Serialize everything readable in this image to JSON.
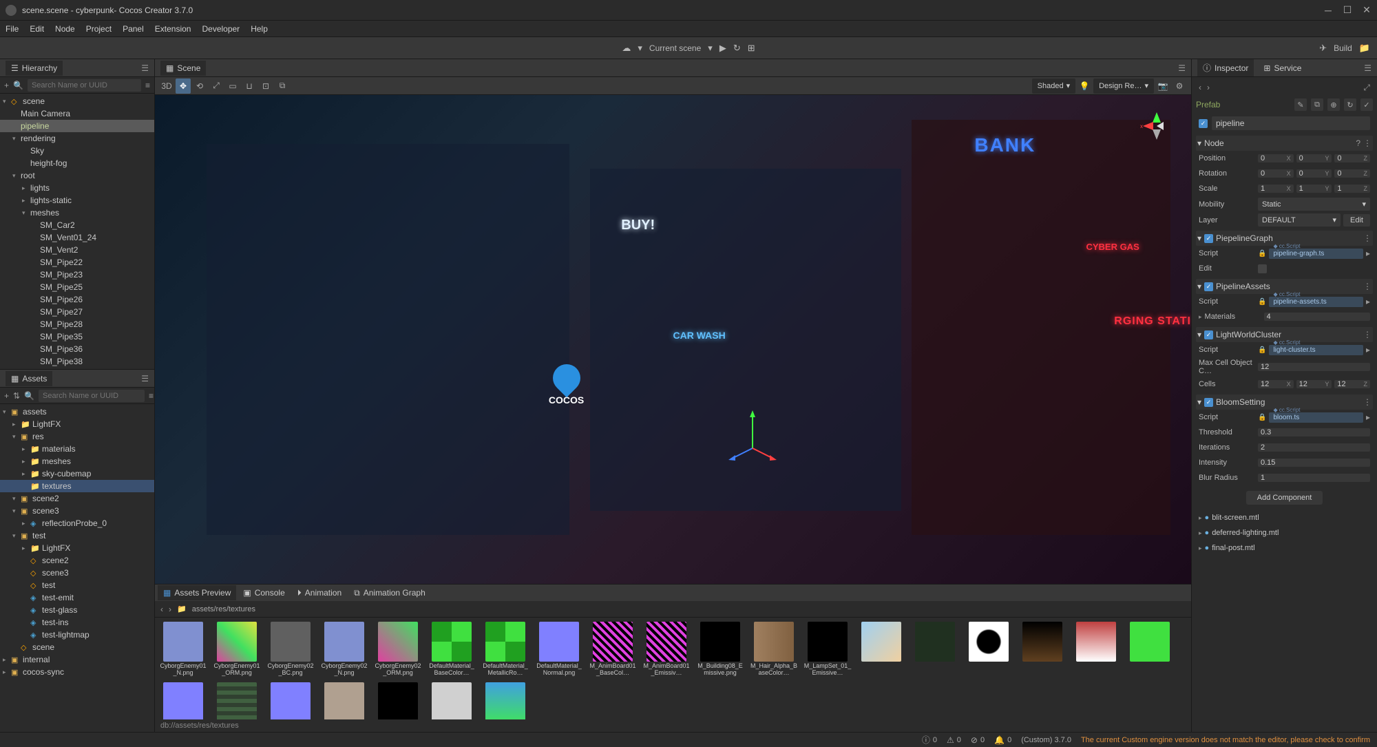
{
  "title": "scene.scene - cyberpunk- Cocos Creator 3.7.0",
  "menubar": [
    "File",
    "Edit",
    "Node",
    "Project",
    "Panel",
    "Extension",
    "Developer",
    "Help"
  ],
  "toolbar": {
    "scene_label": "Current scene",
    "build_label": "Build"
  },
  "tabs": {
    "hierarchy": "Hierarchy",
    "scene": "Scene",
    "assets": "Assets",
    "inspector": "Inspector",
    "service": "Service"
  },
  "search_placeholder": "Search Name or UUID",
  "hierarchy": [
    {
      "label": "scene",
      "indent": 0,
      "arrow": "▾",
      "icon": "node"
    },
    {
      "label": "Main Camera",
      "indent": 1,
      "arrow": "",
      "icon": ""
    },
    {
      "label": "pipeline",
      "indent": 1,
      "arrow": "",
      "icon": "",
      "selected": true
    },
    {
      "label": "rendering",
      "indent": 1,
      "arrow": "▾",
      "icon": ""
    },
    {
      "label": "Sky",
      "indent": 2,
      "arrow": "",
      "icon": ""
    },
    {
      "label": "height-fog",
      "indent": 2,
      "arrow": "",
      "icon": ""
    },
    {
      "label": "root",
      "indent": 1,
      "arrow": "▾",
      "icon": ""
    },
    {
      "label": "lights",
      "indent": 2,
      "arrow": "▸",
      "icon": ""
    },
    {
      "label": "lights-static",
      "indent": 2,
      "arrow": "▸",
      "icon": ""
    },
    {
      "label": "meshes",
      "indent": 2,
      "arrow": "▾",
      "icon": ""
    },
    {
      "label": "SM_Car2",
      "indent": 3,
      "arrow": "",
      "icon": ""
    },
    {
      "label": "SM_Vent01_24",
      "indent": 3,
      "arrow": "",
      "icon": ""
    },
    {
      "label": "SM_Vent2",
      "indent": 3,
      "arrow": "",
      "icon": ""
    },
    {
      "label": "SM_Pipe22",
      "indent": 3,
      "arrow": "",
      "icon": ""
    },
    {
      "label": "SM_Pipe23",
      "indent": 3,
      "arrow": "",
      "icon": ""
    },
    {
      "label": "SM_Pipe25",
      "indent": 3,
      "arrow": "",
      "icon": ""
    },
    {
      "label": "SM_Pipe26",
      "indent": 3,
      "arrow": "",
      "icon": ""
    },
    {
      "label": "SM_Pipe27",
      "indent": 3,
      "arrow": "",
      "icon": ""
    },
    {
      "label": "SM_Pipe28",
      "indent": 3,
      "arrow": "",
      "icon": ""
    },
    {
      "label": "SM_Pipe35",
      "indent": 3,
      "arrow": "",
      "icon": ""
    },
    {
      "label": "SM_Pipe36",
      "indent": 3,
      "arrow": "",
      "icon": ""
    },
    {
      "label": "SM_Pipe38",
      "indent": 3,
      "arrow": "",
      "icon": ""
    }
  ],
  "assets_tree": [
    {
      "label": "assets",
      "indent": 0,
      "arrow": "▾",
      "icon": "folder"
    },
    {
      "label": "LightFX",
      "indent": 1,
      "arrow": "▸",
      "icon": "folder-blue"
    },
    {
      "label": "res",
      "indent": 1,
      "arrow": "▾",
      "icon": "folder"
    },
    {
      "label": "materials",
      "indent": 2,
      "arrow": "▸",
      "icon": "folder-blue"
    },
    {
      "label": "meshes",
      "indent": 2,
      "arrow": "▸",
      "icon": "folder-blue"
    },
    {
      "label": "sky-cubemap",
      "indent": 2,
      "arrow": "▸",
      "icon": "folder-blue"
    },
    {
      "label": "textures",
      "indent": 2,
      "arrow": "",
      "icon": "folder-blue",
      "highlighted": true
    },
    {
      "label": "scene2",
      "indent": 1,
      "arrow": "▾",
      "icon": "folder"
    },
    {
      "label": "scene3",
      "indent": 1,
      "arrow": "▾",
      "icon": "folder"
    },
    {
      "label": "reflectionProbe_0",
      "indent": 2,
      "arrow": "▸",
      "icon": "file"
    },
    {
      "label": "test",
      "indent": 1,
      "arrow": "▾",
      "icon": "folder"
    },
    {
      "label": "LightFX",
      "indent": 2,
      "arrow": "▸",
      "icon": "folder-blue"
    },
    {
      "label": "scene2",
      "indent": 2,
      "arrow": "",
      "icon": "node"
    },
    {
      "label": "scene3",
      "indent": 2,
      "arrow": "",
      "icon": "node"
    },
    {
      "label": "test",
      "indent": 2,
      "arrow": "",
      "icon": "node"
    },
    {
      "label": "test-emit",
      "indent": 2,
      "arrow": "",
      "icon": "file"
    },
    {
      "label": "test-glass",
      "indent": 2,
      "arrow": "",
      "icon": "file"
    },
    {
      "label": "test-ins",
      "indent": 2,
      "arrow": "",
      "icon": "file"
    },
    {
      "label": "test-lightmap",
      "indent": 2,
      "arrow": "",
      "icon": "file"
    },
    {
      "label": "scene",
      "indent": 1,
      "arrow": "",
      "icon": "node"
    },
    {
      "label": "internal",
      "indent": 0,
      "arrow": "▸",
      "icon": "folder"
    },
    {
      "label": "cocos-sync",
      "indent": 0,
      "arrow": "▸",
      "icon": "folder"
    }
  ],
  "viewport": {
    "mode3d": "3D",
    "shaded": "Shaded",
    "render_mode": "Design Re…",
    "neon": {
      "bank": "BANK",
      "buy": "BUY!",
      "carwash": "CAR WASH",
      "cybergas": "CYBER GAS",
      "charging": "RGING STATI"
    },
    "logo_text": "COCOS"
  },
  "bottom_tabs": {
    "preview": "Assets Preview",
    "console": "Console",
    "animation": "Animation",
    "graph": "Animation Graph"
  },
  "breadcrumb_path": "assets/res/textures",
  "status_path": "db://assets/res/textures",
  "thumbnails": [
    {
      "name": "CyborgEnemy01_N.png",
      "color": "#8090d0"
    },
    {
      "name": "CyborgEnemy01_ORM.png",
      "color": "linear-gradient(45deg,#e040a0,#40e060,#e0e040)"
    },
    {
      "name": "CyborgEnemy02_BC.png",
      "color": "#606060"
    },
    {
      "name": "CyborgEnemy02_N.png",
      "color": "#8090d0"
    },
    {
      "name": "CyborgEnemy02_ORM.png",
      "color": "linear-gradient(45deg,#e040a0,#40e060)"
    },
    {
      "name": "DefaultMaterial_BaseColor…",
      "color": "repeating-conic-gradient(#40e040 0 25%,#20a020 0 50%)"
    },
    {
      "name": "DefaultMaterial_MetallicRo…",
      "color": "repeating-conic-gradient(#40e040 0 25%,#20a020 0 50%)"
    },
    {
      "name": "DefaultMaterial_Normal.png",
      "color": "#8080ff"
    },
    {
      "name": "M_AnimBoard01_BaseCol…",
      "color": "repeating-linear-gradient(45deg,#e040e0 0 4px,#000 4px 8px)"
    },
    {
      "name": "M_AnimBoard01_Emissiv…",
      "color": "repeating-linear-gradient(45deg,#e040e0 0 4px,#000 4px 8px)"
    },
    {
      "name": "M_Building08_Emissive.png",
      "color": "#000"
    },
    {
      "name": "M_Hair_Alpha_BaseColor…",
      "color": "linear-gradient(90deg,#a08060,#806040)"
    },
    {
      "name": "M_LampSet_01_Emissive…",
      "color": "#000"
    },
    {
      "name": "",
      "color": "linear-gradient(135deg,#a0d0f0,#f0d0a0)"
    },
    {
      "name": "",
      "color": "#203020"
    },
    {
      "name": "",
      "color": "radial-gradient(#000 40%,#fff 45%)"
    },
    {
      "name": "",
      "color": "linear-gradient(#000,#604020)"
    },
    {
      "name": "",
      "color": "linear-gradient(#c04040,#fff)"
    },
    {
      "name": "",
      "color": "#40e040"
    },
    {
      "name": "",
      "color": "#8080ff"
    },
    {
      "name": "",
      "color": "repeating-linear-gradient(#406040 0 6px,#304030 6px 12px)"
    },
    {
      "name": "",
      "color": "#8080ff"
    },
    {
      "name": "",
      "color": "#b0a090"
    },
    {
      "name": "",
      "color": "#000"
    },
    {
      "name": "",
      "color": "#d0d0d0"
    },
    {
      "name": "",
      "color": "linear-gradient(#40a0e0,#40e060)"
    }
  ],
  "inspector": {
    "prefab_label": "Prefab",
    "node_name": "pipeline",
    "node_section": "Node",
    "position_label": "Position",
    "rotation_label": "Rotation",
    "scale_label": "Scale",
    "mobility_label": "Mobility",
    "layer_label": "Layer",
    "position": {
      "x": "0",
      "y": "0",
      "z": "0"
    },
    "rotation": {
      "x": "0",
      "y": "0",
      "z": "0"
    },
    "scale": {
      "x": "1",
      "y": "1",
      "z": "1"
    },
    "mobility": "Static",
    "layer": "DEFAULT",
    "edit_btn": "Edit",
    "cc_script": "cc.Script",
    "components": [
      {
        "name": "PiepelineGraph",
        "script": "pipeline-graph.ts",
        "extra": [
          {
            "label": "Edit",
            "type": "checkbox"
          }
        ]
      },
      {
        "name": "PipelineAssets",
        "script": "pipeline-assets.ts",
        "extra": [
          {
            "label": "Materials",
            "type": "expand",
            "value": "4"
          }
        ]
      },
      {
        "name": "LightWorldCluster",
        "script": "light-cluster.ts",
        "cells": {
          "x": "12",
          "y": "12",
          "z": "12"
        },
        "extra": [
          {
            "label": "Max Cell Object C…",
            "type": "number",
            "value": "12"
          }
        ]
      },
      {
        "name": "BloomSetting",
        "script": "bloom.ts",
        "props": [
          {
            "label": "Threshold",
            "value": "0.3"
          },
          {
            "label": "Iterations",
            "value": "2"
          },
          {
            "label": "Intensity",
            "value": "0.15"
          },
          {
            "label": "Blur Radius",
            "value": "1"
          }
        ]
      }
    ],
    "cells_label": "Cells",
    "script_label": "Script",
    "add_component": "Add Component",
    "materials": [
      "blit-screen.mtl",
      "deferred-lighting.mtl",
      "final-post.mtl"
    ]
  },
  "statusbar": {
    "info": "0",
    "warn": "0",
    "error": "0",
    "notif": "0",
    "version": "(Custom) 3.7.0",
    "message": "The current Custom engine version does not match the editor, please check to confirm"
  }
}
